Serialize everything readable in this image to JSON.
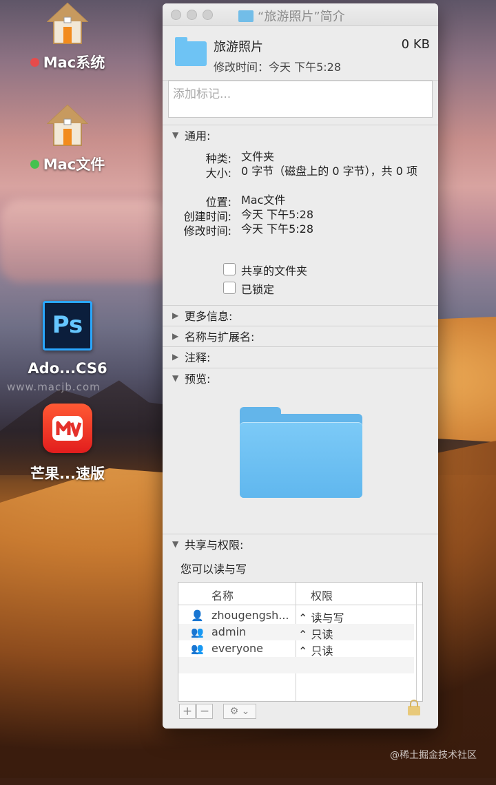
{
  "desktop": {
    "icons": [
      {
        "label": "Mac系统",
        "dot_color": "#e64b4b"
      },
      {
        "label": "Mac文件",
        "dot_color": "#44c24f"
      },
      {
        "label": "Ado...CS6",
        "icon_text": "Ps"
      },
      {
        "label": "芒果...速版"
      }
    ],
    "watermark": "www.macjb.com",
    "footer_watermark": "@稀土掘金技术社区"
  },
  "window": {
    "title": "“旅游照片”简介",
    "name": "旅游照片",
    "modified_header": "修改时间：今天 下午5:28",
    "size_header": "0 KB",
    "tags_placeholder": "添加标记...",
    "general": {
      "header": "通用:",
      "kind_label": "种类:",
      "kind": "文件夹",
      "size_label": "大小:",
      "size": "0 字节（磁盘上的 0 字节），共 0 项",
      "where_label": "位置:",
      "where": "Mac文件",
      "created_label": "创建时间:",
      "created": "今天 下午5:28",
      "modified_label": "修改时间:",
      "modified": "今天 下午5:28",
      "shared_folder": "共享的文件夹",
      "locked": "已锁定"
    },
    "sections": {
      "more_info": "更多信息:",
      "name_ext": "名称与扩展名:",
      "comments": "注释:",
      "preview": "预览:",
      "sharing": "共享与权限:"
    },
    "sharing": {
      "summary": "您可以读与写",
      "col_name": "名称",
      "col_priv": "权限",
      "rows": [
        {
          "name": "zhougengsh...",
          "priv": "读与写"
        },
        {
          "name": "admin",
          "priv": "只读"
        },
        {
          "name": "everyone",
          "priv": "只读"
        }
      ]
    },
    "buttons": {
      "add": "+",
      "remove": "−",
      "gear": "⚙ ⌄"
    }
  }
}
